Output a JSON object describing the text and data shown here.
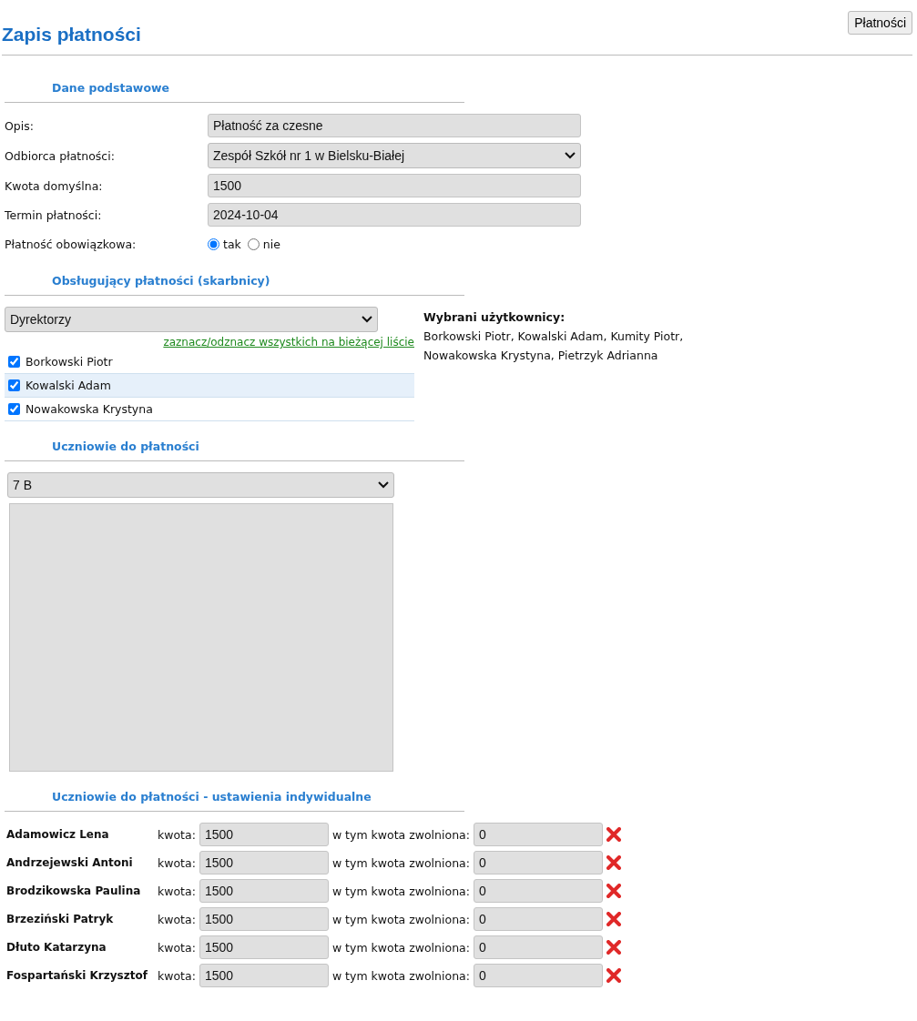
{
  "header": {
    "title": "Zapis płatności",
    "button": "Płatności"
  },
  "basic": {
    "heading": "Dane podstawowe",
    "fields": [
      {
        "kind": "text",
        "label": "Opis:",
        "value": "Płatność za czesne"
      },
      {
        "kind": "select",
        "label": "Odbiorca płatności:",
        "value": "Zespół Szkół nr 1 w Bielsku-Białej"
      },
      {
        "kind": "text",
        "label": "Kwota domyślna:",
        "value": "1500"
      },
      {
        "kind": "text",
        "label": "Termin płatności:",
        "value": "2024-10-04"
      },
      {
        "kind": "radio",
        "label": "Płatność obowiązkowa:",
        "options": [
          {
            "label": "tak",
            "selected": true
          },
          {
            "label": "nie",
            "selected": false
          }
        ]
      }
    ]
  },
  "treasurers": {
    "heading": "Obsługujący płatności (skarbnicy)",
    "group": "Dyrektorzy",
    "toggle_link": "zaznacz/odznacz wszystkich na bieżącej liście",
    "users": [
      {
        "name": "Borkowski Piotr",
        "checked": true,
        "highlighted": false
      },
      {
        "name": "Kowalski Adam",
        "checked": true,
        "highlighted": true
      },
      {
        "name": "Nowakowska Krystyna",
        "checked": true,
        "highlighted": false
      }
    ],
    "selected_title": "Wybrani użytkownicy:",
    "selected_list": "Borkowski Piotr, Kowalski Adam, Kumity Piotr, Nowakowska Krystyna, Pietrzyk Adrianna"
  },
  "students": {
    "heading": "Uczniowie do płatności",
    "class": "7 B"
  },
  "individual": {
    "heading": "Uczniowie do płatności - ustawienia indywidualne",
    "rows": [
      {
        "name": "Adamowicz Lena",
        "amount_label": "kwota:",
        "amount": "1500",
        "exempt_label": "w tym kwota zwolniona:",
        "exempt": "0"
      },
      {
        "name": "Andrzejewski Antoni",
        "amount_label": "kwota:",
        "amount": "1500",
        "exempt_label": "w tym kwota zwolniona:",
        "exempt": "0"
      },
      {
        "name": "Brodzikowska Paulina",
        "amount_label": "kwota:",
        "amount": "1500",
        "exempt_label": "w tym kwota zwolniona:",
        "exempt": "0"
      },
      {
        "name": "Brzeziński Patryk",
        "amount_label": "kwota:",
        "amount": "1500",
        "exempt_label": "w tym kwota zwolniona:",
        "exempt": "0"
      },
      {
        "name": "Dłuto Katarzyna",
        "amount_label": "kwota:",
        "amount": "1500",
        "exempt_label": "w tym kwota zwolniona:",
        "exempt": "0"
      },
      {
        "name": "Fospartański Krzysztof",
        "amount_label": "kwota:",
        "amount": "1500",
        "exempt_label": "w tym kwota zwolniona:",
        "exempt": "0"
      }
    ]
  }
}
